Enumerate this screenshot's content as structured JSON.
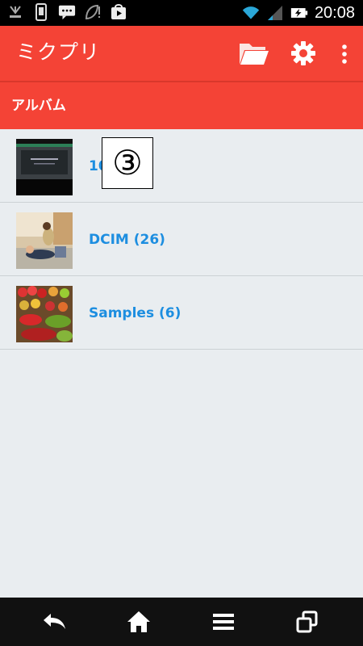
{
  "status_bar": {
    "time": "20:08",
    "icons": [
      "download-icon",
      "phone-icon",
      "message-icon",
      "leaf-alert-icon",
      "play-store-icon",
      "wifi-icon",
      "signal-icon",
      "battery-charging-icon"
    ]
  },
  "app_bar": {
    "title": "ミクプリ",
    "actions": [
      "folder-icon",
      "gear-icon",
      "more-vert-icon"
    ],
    "accent_color": "#f44336"
  },
  "section": {
    "title": "アルバム"
  },
  "albums": [
    {
      "label": "10  (10)",
      "thumb": "screen-photo-thumbnail"
    },
    {
      "label": "DCIM (26)",
      "thumb": "people-photo-thumbnail"
    },
    {
      "label": "Samples (6)",
      "thumb": "vegetables-photo-thumbnail"
    }
  ],
  "overlay": {
    "text": "③"
  },
  "nav_bar": {
    "buttons": [
      "back-icon",
      "home-icon",
      "menu-icon",
      "recent-apps-icon"
    ]
  }
}
